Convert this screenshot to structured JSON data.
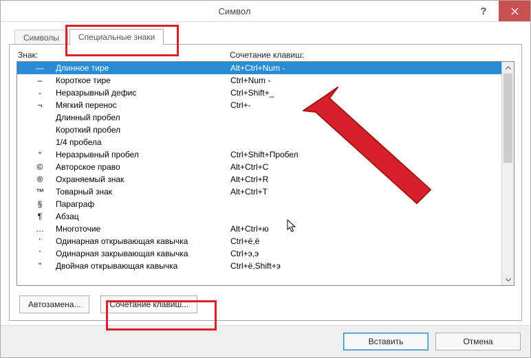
{
  "window": {
    "title": "Символ"
  },
  "tabs": {
    "symbols": "Символы",
    "special": "Специальные знаки"
  },
  "headers": {
    "znak": "Знак:",
    "shortcut": "Сочетание клавиш:"
  },
  "rows": [
    {
      "sym": "—",
      "name": "Длинное тире",
      "shortcut": "Alt+Ctrl+Num -"
    },
    {
      "sym": "–",
      "name": "Короткое тире",
      "shortcut": "Ctrl+Num -"
    },
    {
      "sym": "-",
      "name": "Неразрывный дефис",
      "shortcut": "Ctrl+Shift+_"
    },
    {
      "sym": "¬",
      "name": "Мягкий перенос",
      "shortcut": "Ctrl+-"
    },
    {
      "sym": "",
      "name": "Длинный пробел",
      "shortcut": ""
    },
    {
      "sym": "",
      "name": "Короткий пробел",
      "shortcut": ""
    },
    {
      "sym": "",
      "name": "1/4 пробела",
      "shortcut": ""
    },
    {
      "sym": "°",
      "name": "Неразрывный пробел",
      "shortcut": "Ctrl+Shift+Пробел"
    },
    {
      "sym": "©",
      "name": "Авторское право",
      "shortcut": "Alt+Ctrl+C"
    },
    {
      "sym": "®",
      "name": "Охраняемый знак",
      "shortcut": "Alt+Ctrl+R"
    },
    {
      "sym": "™",
      "name": "Товарный знак",
      "shortcut": "Alt+Ctrl+T"
    },
    {
      "sym": "§",
      "name": "Параграф",
      "shortcut": ""
    },
    {
      "sym": "¶",
      "name": "Абзац",
      "shortcut": ""
    },
    {
      "sym": "…",
      "name": "Многоточие",
      "shortcut": "Alt+Ctrl+ю"
    },
    {
      "sym": "‘",
      "name": "Одинарная открывающая кавычка",
      "shortcut": "Ctrl+ё,ё"
    },
    {
      "sym": "’",
      "name": "Одинарная закрывающая кавычка",
      "shortcut": "Ctrl+э,э"
    },
    {
      "sym": "\"",
      "name": "Двойная открывающая кавычка",
      "shortcut": "Ctrl+ё,Shift+э"
    }
  ],
  "buttons": {
    "autoreplace": "Автозамена...",
    "shortcut": "Сочетание клавиш...",
    "insert": "Вставить",
    "cancel": "Отмена"
  }
}
